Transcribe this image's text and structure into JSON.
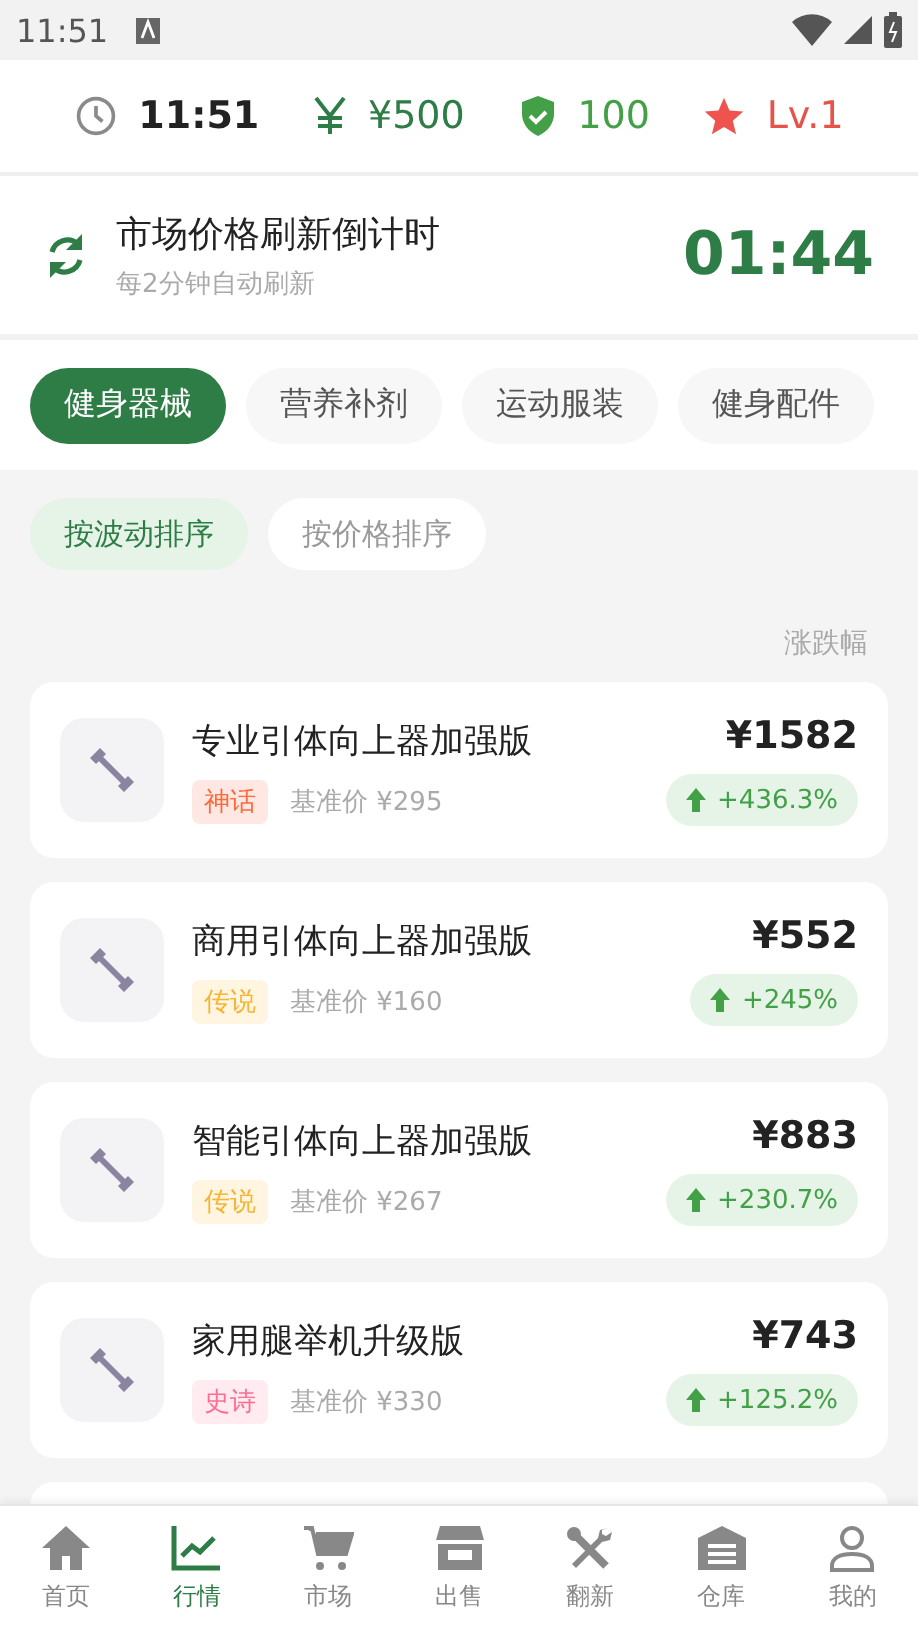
{
  "status_bar": {
    "time": "11:51"
  },
  "stats": [
    {
      "value": "11:51",
      "kind": "time"
    },
    {
      "value": "¥500",
      "kind": "money"
    },
    {
      "value": "100",
      "kind": "reputation"
    },
    {
      "value": "Lv.1",
      "kind": "level"
    }
  ],
  "countdown": {
    "title": "市场价格刷新倒计时",
    "subtitle": "每2分钟自动刷新",
    "time": "01:44"
  },
  "categories": [
    {
      "label": "健身器械",
      "selected": true
    },
    {
      "label": "营养补剂",
      "selected": false
    },
    {
      "label": "运动服装",
      "selected": false
    },
    {
      "label": "健身配件",
      "selected": false
    }
  ],
  "sort_options": [
    {
      "label": "按波动排序",
      "selected": true
    },
    {
      "label": "按价格排序",
      "selected": false
    }
  ],
  "change_header": "涨跌幅",
  "items": [
    {
      "name": "专业引体向上器加强版",
      "tag": "神话",
      "kind": "mythic",
      "base_price": "基准价 ¥295",
      "price": "¥1582",
      "change": "+436.3%"
    },
    {
      "name": "商用引体向上器加强版",
      "tag": "传说",
      "kind": "legendary",
      "base_price": "基准价 ¥160",
      "price": "¥552",
      "change": "+245%"
    },
    {
      "name": "智能引体向上器加强版",
      "tag": "传说",
      "kind": "legendary",
      "base_price": "基准价 ¥267",
      "price": "¥883",
      "change": "+230.7%"
    },
    {
      "name": "家用腿举机升级版",
      "tag": "史诗",
      "kind": "epic",
      "base_price": "基准价 ¥330",
      "price": "¥743",
      "change": "+125.2%"
    }
  ],
  "nav": [
    {
      "label": "首页",
      "selected": false
    },
    {
      "label": "行情",
      "selected": true
    },
    {
      "label": "市场",
      "selected": false
    },
    {
      "label": "出售",
      "selected": false
    },
    {
      "label": "翻新",
      "selected": false
    },
    {
      "label": "仓库",
      "selected": false
    },
    {
      "label": "我的",
      "selected": false
    }
  ]
}
